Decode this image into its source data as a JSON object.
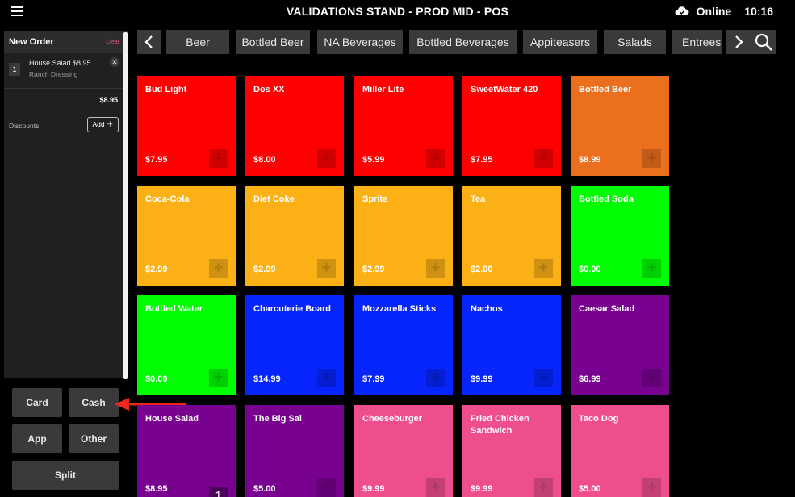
{
  "header": {
    "title": "VALIDATIONS STAND - PROD MID - POS",
    "status": "Online",
    "time": "10:16"
  },
  "order": {
    "title": "New Order",
    "clear_label": "Clear",
    "items": [
      {
        "qty": "1",
        "name": "House Salad $8.95",
        "modifier": "Ranch Dressing"
      }
    ],
    "subtotal": "$8.95",
    "discounts_label": "Discounts",
    "add_label": "Add ＋"
  },
  "payment": {
    "card": "Card",
    "cash": "Cash",
    "app": "App",
    "other": "Other",
    "split": "Split"
  },
  "categories": [
    "Beer",
    "Bottled Beer",
    "NA Beverages",
    "Bottled Beverages",
    "Appiteasers",
    "Salads",
    "Entrees"
  ],
  "colors": {
    "red": "#fe0000",
    "orange": "#eb6f1c",
    "amber": "#fbb116",
    "green": "#00fd02",
    "blue": "#0625fd",
    "purple": "#780190",
    "pink": "#ef4e8e"
  },
  "tiles": [
    {
      "name": "Bud Light",
      "price": "$7.95",
      "color": "#fe0000",
      "plus": "+"
    },
    {
      "name": "Dos XX",
      "price": "$8.00",
      "color": "#fe0000",
      "plus": "+"
    },
    {
      "name": "Miller Lite",
      "price": "$5.99",
      "color": "#fe0000",
      "plus": "+"
    },
    {
      "name": "SweetWater 420",
      "price": "$7.95",
      "color": "#fe0000",
      "plus": "+"
    },
    {
      "name": "Bottled Beer",
      "price": "$8.99",
      "color": "#eb6f1c",
      "plus": "+"
    },
    {
      "name": "Coca-Cola",
      "price": "$2.99",
      "color": "#fbb116",
      "plus": "+"
    },
    {
      "name": "Diet Coke",
      "price": "$2.99",
      "color": "#fbb116",
      "plus": "+"
    },
    {
      "name": "Sprite",
      "price": "$2.99",
      "color": "#fbb116",
      "plus": "+"
    },
    {
      "name": "Tea",
      "price": "$2.00",
      "color": "#fbb116",
      "plus": "+"
    },
    {
      "name": "Bottled Soda",
      "price": "$0.00",
      "color": "#00fd02",
      "plus": "+"
    },
    {
      "name": "Bottled Water",
      "price": "$0.00",
      "color": "#00fd02",
      "plus": "+"
    },
    {
      "name": "Charcuterie Board",
      "price": "$14.99",
      "color": "#0625fd",
      "plus": "+"
    },
    {
      "name": "Mozzarella Sticks",
      "price": "$7.99",
      "color": "#0625fd",
      "plus": "+"
    },
    {
      "name": "Nachos",
      "price": "$9.99",
      "color": "#0625fd",
      "plus": "+"
    },
    {
      "name": "Caesar Salad",
      "price": "$6.99",
      "color": "#780190",
      "plus": "+"
    },
    {
      "name": "House Salad",
      "price": "$8.95",
      "color": "#780190",
      "qty": "1"
    },
    {
      "name": "The Big Sal",
      "price": "$5.00",
      "color": "#780190",
      "plus": "+"
    },
    {
      "name": "Cheeseburger",
      "price": "$9.99",
      "color": "#ef4e8e",
      "plus": "+"
    },
    {
      "name": "Fried Chicken Sandwich",
      "price": "$9.99",
      "color": "#ef4e8e",
      "plus": "+"
    },
    {
      "name": "Taco Dog",
      "price": "$5.00",
      "color": "#ef4e8e",
      "plus": "+"
    }
  ]
}
